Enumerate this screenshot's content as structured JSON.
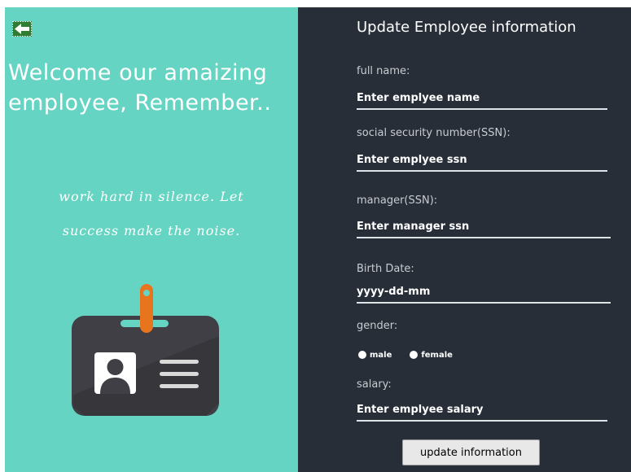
{
  "left_panel": {
    "welcome_line1": "Welcome our amaizing",
    "welcome_line2": "employee, Remember..",
    "quote_line1": "work hard in silence. Let",
    "quote_line2": "success make the noise.",
    "back_icon": "back-arrow-icon",
    "illustration_icon": "id-badge-icon"
  },
  "form": {
    "title": "Update Employee information",
    "full_name": {
      "label": "full name:",
      "placeholder": "Enter emplyee name"
    },
    "ssn": {
      "label": "social security number(SSN):",
      "placeholder": "Enter emplyee ssn"
    },
    "manager": {
      "label": "manager(SSN):",
      "placeholder": "Enter manager ssn"
    },
    "birth_date": {
      "label": "Birth Date:",
      "placeholder": "yyyy-dd-mm"
    },
    "gender": {
      "label": "gender:",
      "options": [
        "male",
        "female"
      ]
    },
    "salary": {
      "label": "salary:",
      "placeholder": "Enter emplyee salary"
    },
    "submit_label": "update information"
  },
  "colors": {
    "left_bg": "#66d4c2",
    "right_bg": "#272e38",
    "badge_body": "#3f3f45",
    "badge_clip": "#e8751e"
  }
}
